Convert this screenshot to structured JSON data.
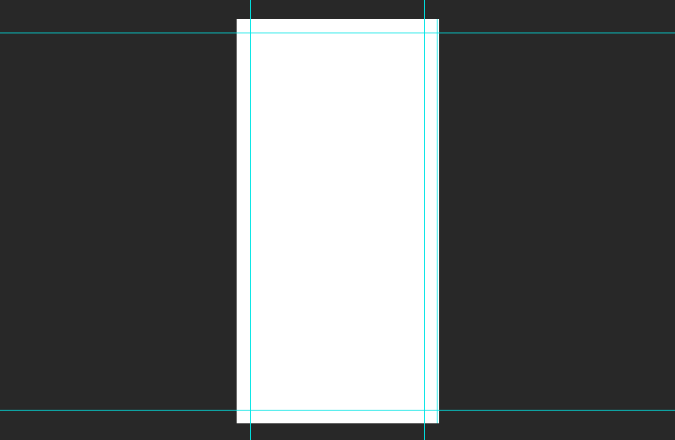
{
  "workspace": {
    "background_color": "#282828"
  },
  "canvas": {
    "fill_color": "#ffffff"
  },
  "guides": {
    "color": "#00e5e5",
    "vertical_count": 3,
    "horizontal_count": 2
  }
}
